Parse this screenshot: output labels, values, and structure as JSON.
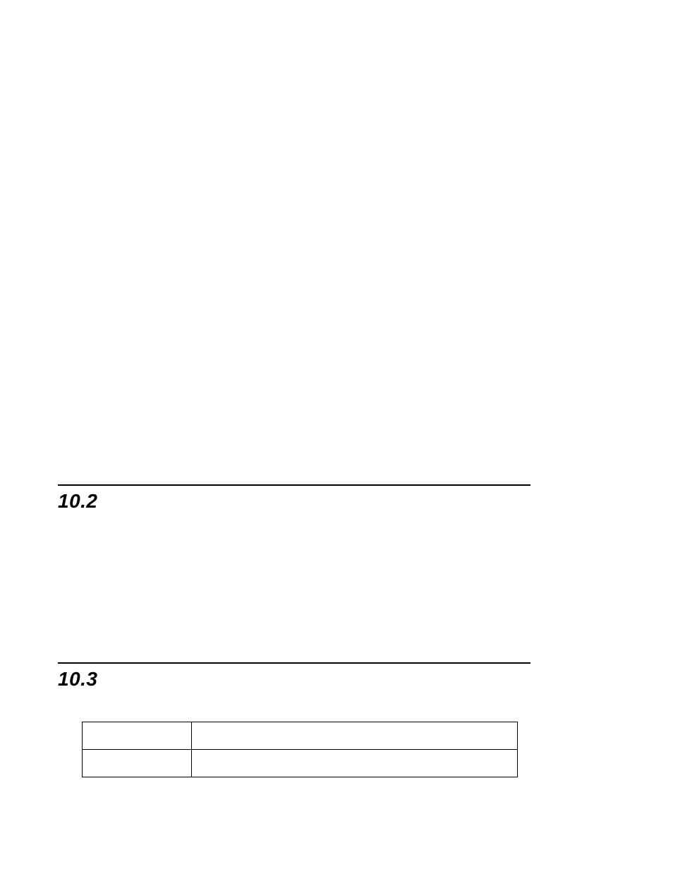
{
  "sections": {
    "s1": {
      "number": "10.2"
    },
    "s2": {
      "number": "10.3"
    }
  },
  "table": {
    "rows": [
      {
        "c1": "",
        "c2": ""
      },
      {
        "c1": "",
        "c2": ""
      }
    ]
  }
}
